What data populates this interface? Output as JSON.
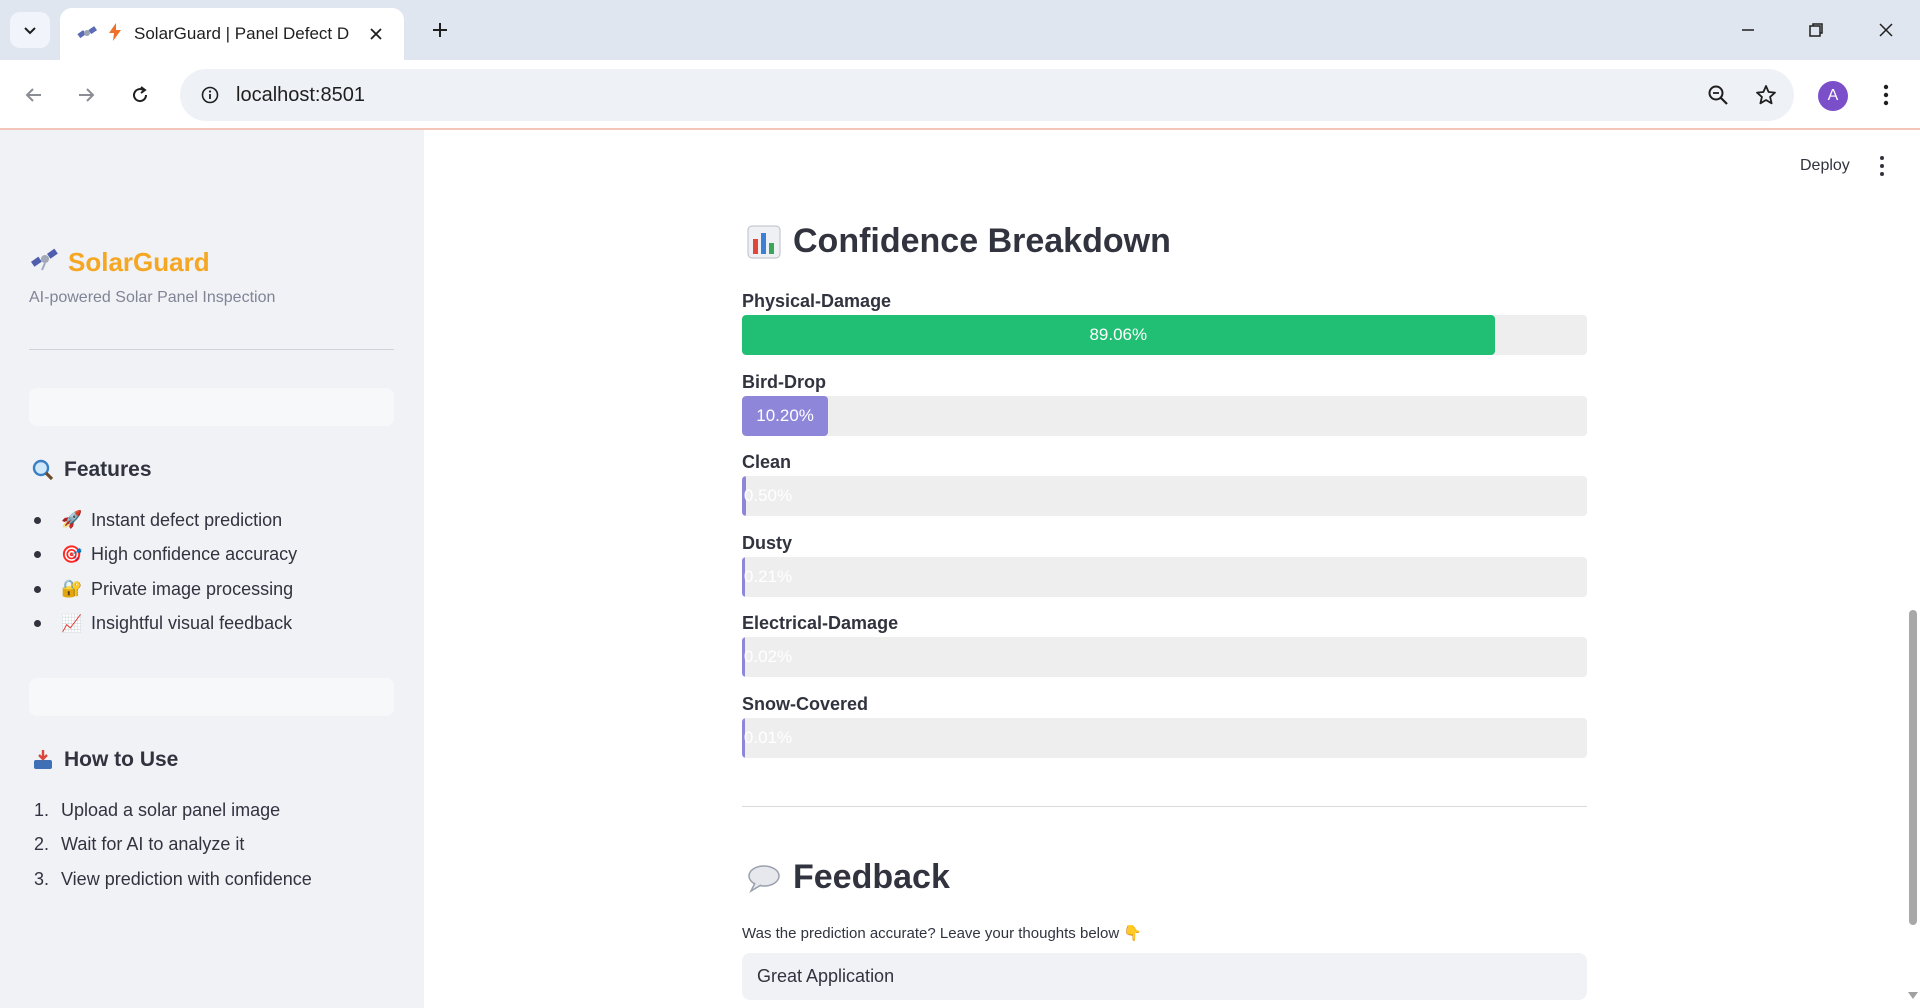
{
  "browser": {
    "tab_title": "SolarGuard | Panel Defect D",
    "url": "localhost:8501",
    "profile_initial": "A"
  },
  "app": {
    "deploy_label": "Deploy"
  },
  "sidebar": {
    "brand": "SolarGuard",
    "subtitle": "AI-powered Solar Panel Inspection",
    "features_title": "Features",
    "features": [
      {
        "emoji": "🚀",
        "label": "Instant defect prediction"
      },
      {
        "emoji": "🎯",
        "label": "High confidence accuracy"
      },
      {
        "emoji": "🔐",
        "label": "Private image processing"
      },
      {
        "emoji": "📈",
        "label": "Insightful visual feedback"
      }
    ],
    "howto_title": "How to Use",
    "steps": [
      {
        "num": "1.",
        "label": "Upload a solar panel image"
      },
      {
        "num": "2.",
        "label": "Wait for AI to analyze it"
      },
      {
        "num": "3.",
        "label": "View prediction with confidence"
      }
    ]
  },
  "main": {
    "confidence_title": "Confidence Breakdown",
    "bars": [
      {
        "label": "Physical-Damage",
        "value": 89.06,
        "text": "89.06%",
        "color": "#21bf73"
      },
      {
        "label": "Bird-Drop",
        "value": 10.2,
        "text": "10.20%",
        "color": "#8e86d8"
      },
      {
        "label": "Clean",
        "value": 0.5,
        "text": "0.50%",
        "color": "#8e86d8"
      },
      {
        "label": "Dusty",
        "value": 0.21,
        "text": "0.21%",
        "color": "#8e86d8"
      },
      {
        "label": "Electrical-Damage",
        "value": 0.02,
        "text": "0.02%",
        "color": "#8e86d8"
      },
      {
        "label": "Snow-Covered",
        "value": 0.01,
        "text": "0.01%",
        "color": "#8e86d8"
      }
    ],
    "feedback_title": "Feedback",
    "feedback_prompt": "Was the prediction accurate? Leave your thoughts below 👇",
    "feedback_value": "Great Application"
  }
}
